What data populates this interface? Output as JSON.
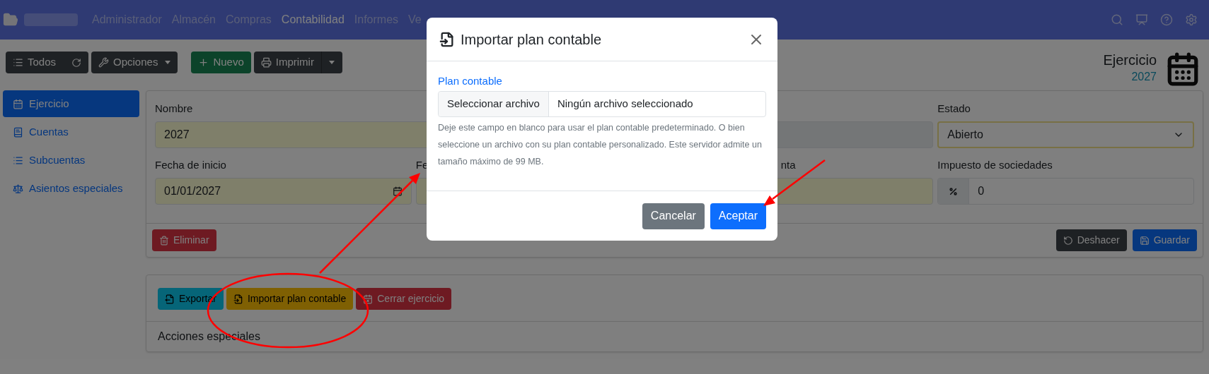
{
  "navbar": {
    "menu": [
      {
        "label": "Administrador",
        "selected": false
      },
      {
        "label": "Almacén",
        "selected": false
      },
      {
        "label": "Compras",
        "selected": false
      },
      {
        "label": "Contabilidad",
        "selected": true
      },
      {
        "label": "Informes",
        "selected": false
      },
      {
        "label": "Ve",
        "selected": false
      }
    ]
  },
  "toolbar": [
    {
      "label": "Todos"
    },
    {
      "label": "Opciones"
    },
    {
      "label": "Nuevo"
    },
    {
      "label": "Imprimir"
    }
  ],
  "header": {
    "title": "Ejercicio",
    "subtitle": "2027"
  },
  "sidebar": {
    "items": [
      {
        "label": "Ejercicio",
        "selected": true
      },
      {
        "label": "Cuentas",
        "selected": false
      },
      {
        "label": "Subcuentas",
        "selected": false
      },
      {
        "label": "Asientos especiales",
        "selected": false
      }
    ]
  },
  "form": {
    "rows": [
      [
        {
          "kind": "text",
          "label": "Nombre",
          "value": "2027",
          "required": true
        },
        "",
        {
          "kind": "readonly"
        },
        {
          "kind": "select",
          "label": "Estado",
          "value": "Abierto",
          "required": true
        }
      ],
      [
        {
          "kind": "date",
          "label": "Fecha de inicio",
          "value": "01/01/2027",
          "required": true
        },
        {
          "kind": "date",
          "label": "Fe",
          "required": true
        },
        {
          "kind": "text",
          "label": "nta",
          "required": true
        },
        {
          "kind": "addon",
          "label": "Impuesto de sociedades",
          "value": "0",
          "required": false
        }
      ]
    ],
    "footer_left": [
      {
        "label": "Eliminar"
      }
    ],
    "footer_right": [
      {
        "label": "Deshacer"
      },
      {
        "label": "Guardar"
      }
    ]
  },
  "special_actions": {
    "buttons": [
      {
        "label": "Exportar"
      },
      {
        "label": "Importar plan contable"
      },
      {
        "label": "Cerrar ejercicio"
      }
    ],
    "footer": "Acciones especiales"
  },
  "modal": {
    "title": "Importar plan contable",
    "field_label": "Plan contable",
    "file_button": "Seleccionar archivo",
    "file_status": "Ningún archivo seleccionado",
    "help": "Deje este campo en blanco para usar el plan contable predeterminado. O bien seleccione un archivo con su plan contable personalizado. Este servidor admite un tamaño máximo de 99 MB.",
    "buttons": [
      {
        "label": "Cancelar"
      },
      {
        "label": "Aceptar"
      }
    ]
  }
}
